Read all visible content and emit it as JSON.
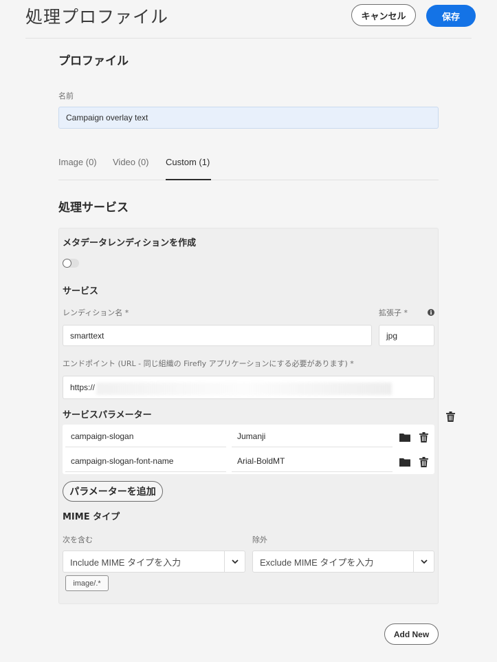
{
  "header": {
    "title": "処理プロファイル",
    "cancel_label": "キャンセル",
    "save_label": "保存"
  },
  "profile": {
    "section_title": "プロファイル",
    "name_label": "名前",
    "name_value": "Campaign overlay text"
  },
  "tabs": [
    {
      "label": "Image (0)",
      "active": false
    },
    {
      "label": "Video (0)",
      "active": false
    },
    {
      "label": "Custom (1)",
      "active": true
    }
  ],
  "services": {
    "section_title": "処理サービス",
    "metadata_title": "メタデータレンディションを作成",
    "metadata_toggle": false,
    "service_title": "サービス",
    "rendition_label": "レンディション名 *",
    "rendition_value": "smarttext",
    "extension_label": "拡張子 *",
    "extension_value": "jpg",
    "endpoint_label": "エンドポイント (URL - 同じ組織の Firefly アプリケーションにする必要があります) *",
    "endpoint_value": "https://",
    "params_title": "サービスパラメーター",
    "params": [
      {
        "name": "campaign-slogan",
        "value": "Jumanji"
      },
      {
        "name": "campaign-slogan-font-name",
        "value": "Arial-BoldMT"
      }
    ],
    "add_param_label": "パラメーターを追加",
    "mime_title": "MIME タイプ",
    "include_label": "次を含む",
    "include_placeholder": "Include MIME タイプを入力",
    "exclude_label": "除外",
    "exclude_placeholder": "Exclude MIME タイプを入力",
    "include_tag": "image/.*"
  },
  "add_new_label": "Add New",
  "colors": {
    "accent": "#1473e6",
    "background": "#f5f5f5",
    "panel": "#efefef"
  }
}
